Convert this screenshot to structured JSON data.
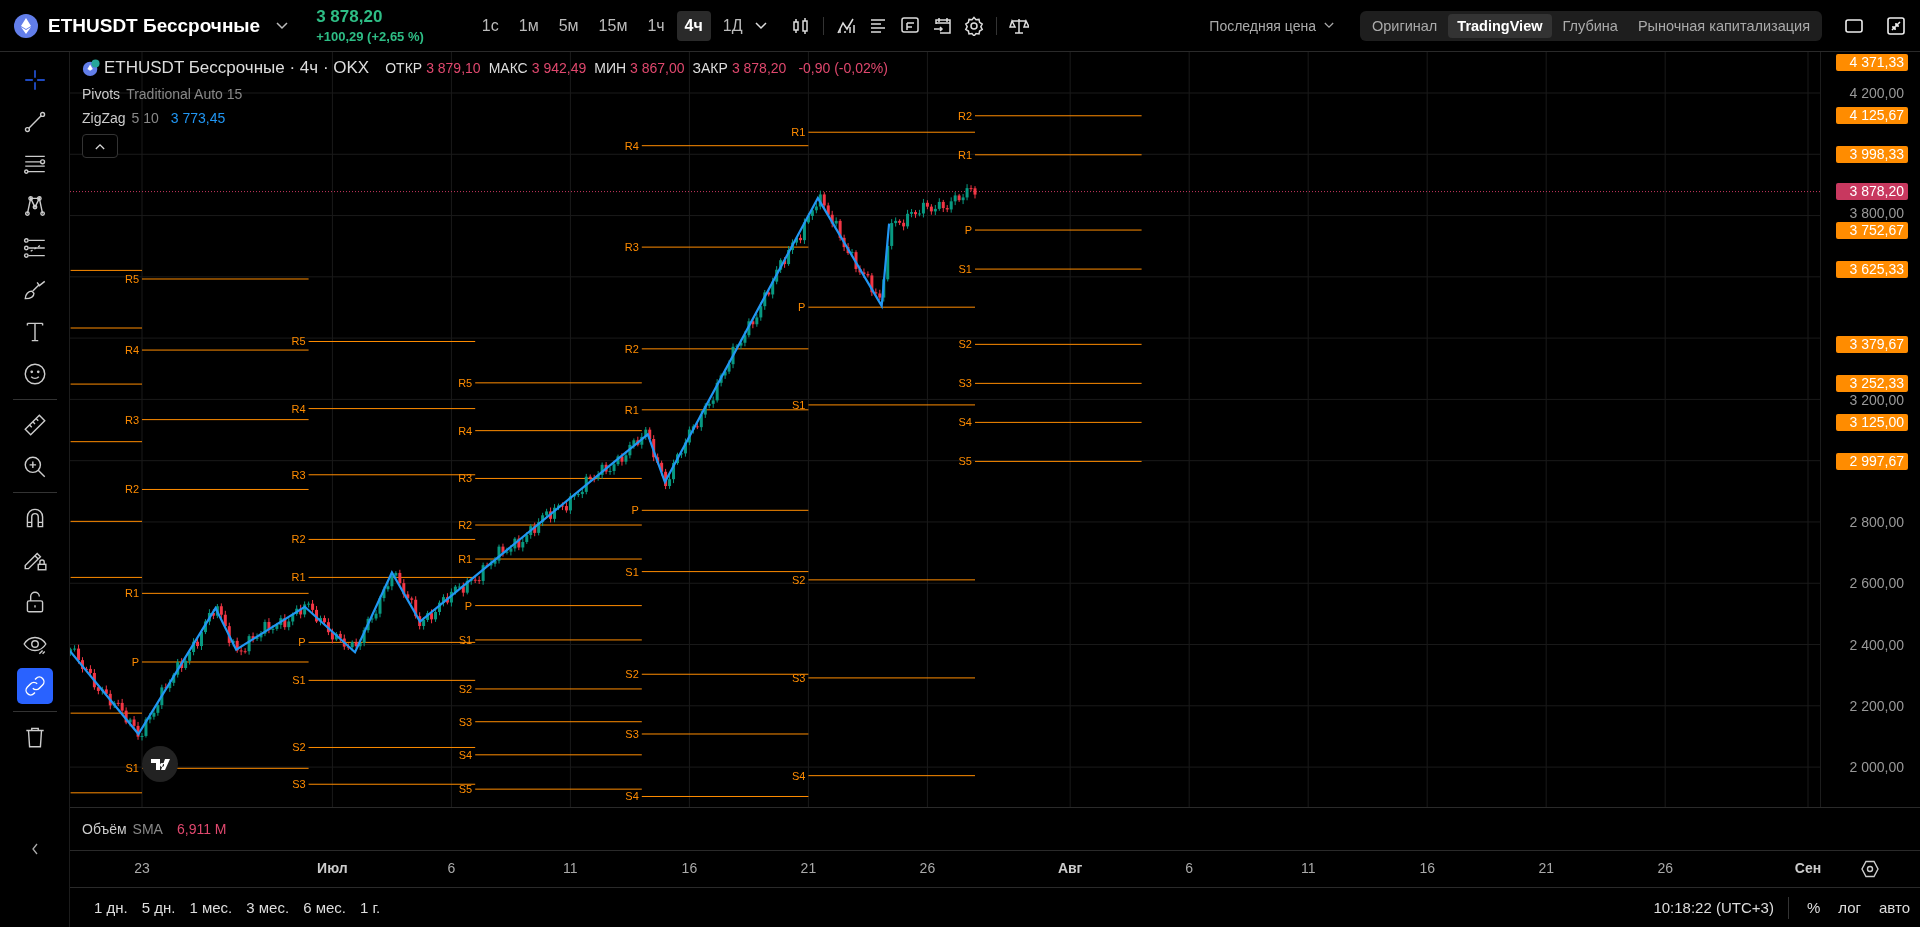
{
  "top_bar": {
    "symbol": "ETHUSDT Бессрочные",
    "price": "3 878,20",
    "change": "+100,29 (+2,65 %)",
    "intervals": [
      {
        "label": "1с",
        "selected": false
      },
      {
        "label": "1м",
        "selected": false
      },
      {
        "label": "5м",
        "selected": false
      },
      {
        "label": "15м",
        "selected": false
      },
      {
        "label": "1ч",
        "selected": false
      },
      {
        "label": "4ч",
        "selected": true
      },
      {
        "label": "1Д",
        "selected": false
      }
    ],
    "price_source": "Последняя цена",
    "views": [
      {
        "label": "Оригинал",
        "selected": false
      },
      {
        "label": "TradingView",
        "selected": true
      },
      {
        "label": "Глубина",
        "selected": false
      },
      {
        "label": "Рыночная капитализация",
        "selected": false
      }
    ]
  },
  "tool_groups": [
    {
      "tools": [
        {
          "kind": "crosshair",
          "selected": true,
          "on": false
        },
        {
          "kind": "line",
          "selected": false,
          "on": false
        },
        {
          "kind": "hlines",
          "selected": false,
          "on": false
        },
        {
          "kind": "pattern",
          "selected": false,
          "on": false
        },
        {
          "kind": "fib",
          "selected": false,
          "on": false
        },
        {
          "kind": "brush",
          "selected": false,
          "on": false
        },
        {
          "kind": "text",
          "selected": false,
          "on": false
        },
        {
          "kind": "smiley",
          "selected": false,
          "on": false
        }
      ]
    },
    {
      "tools": [
        {
          "kind": "ruler",
          "selected": false,
          "on": false
        },
        {
          "kind": "zoom",
          "selected": false,
          "on": false
        }
      ]
    },
    {
      "tools": [
        {
          "kind": "magnet",
          "selected": false,
          "on": false
        },
        {
          "kind": "pencil_lock",
          "selected": false,
          "on": false
        },
        {
          "kind": "lock",
          "selected": false,
          "on": false
        },
        {
          "kind": "eye",
          "selected": false,
          "on": false
        },
        {
          "kind": "link",
          "selected": false,
          "on": true
        }
      ]
    },
    {
      "tools": [
        {
          "kind": "trash",
          "selected": false,
          "on": false
        }
      ]
    }
  ],
  "legend": {
    "title": "ETHUSDT Бессрочные · 4ч · OKX",
    "ohlc": [
      {
        "label": "ОТКР",
        "value": "3 879,10"
      },
      {
        "label": "МАКС",
        "value": "3 942,49"
      },
      {
        "label": "МИН",
        "value": "3 867,00"
      },
      {
        "label": "ЗАКР",
        "value": "3 878,20"
      }
    ],
    "change": "-0,90 (-0,02%)",
    "indicators": [
      {
        "name": "Pivots",
        "params": "Traditional Auto 15"
      },
      {
        "name": "ZigZag",
        "params": "5 10",
        "value": "3 773,45"
      }
    ]
  },
  "chart": {
    "pivot_periods": [
      {
        "labels": [
          "R5",
          "R4",
          "R3",
          "R2",
          "R1",
          "P",
          "S1"
        ]
      },
      {
        "labels": [
          "R5",
          "R4",
          "R3",
          "R2",
          "R1",
          "P",
          "S1",
          "S2",
          "S3"
        ]
      },
      {
        "labels": [
          "R5",
          "R4",
          "R3",
          "R2",
          "R1",
          "P",
          "S1",
          "S2",
          "S3",
          "S4",
          "S5"
        ]
      },
      {
        "labels": [
          "R4",
          "R3",
          "R2",
          "R1",
          "P",
          "S1",
          "S2",
          "S3",
          "S4"
        ]
      },
      {
        "labels": [
          "R1",
          "P",
          "S1",
          "S2",
          "S3",
          "S4"
        ]
      },
      {
        "labels": [
          "R2",
          "R1",
          "P",
          "S1",
          "S2",
          "S3",
          "S4",
          "S5"
        ]
      }
    ],
    "price_ticks": [
      "4 200,00",
      "3 800,00",
      "3 200,00",
      "2 800,00",
      "2 600,00",
      "2 400,00",
      "2 200,00",
      "2 000,00"
    ],
    "price_labels": [
      {
        "text": "4 371,33",
        "color": "#ff8c00"
      },
      {
        "text": "4 125,67",
        "color": "#ff8c00"
      },
      {
        "text": "3 998,33",
        "color": "#ff8c00"
      },
      {
        "text": "3 878,20",
        "color": "#c8385f"
      },
      {
        "text": "3 752,67",
        "color": "#ff8c00"
      },
      {
        "text": "3 625,33",
        "color": "#ff8c00"
      },
      {
        "text": "3 379,67",
        "color": "#ff8c00"
      },
      {
        "text": "3 252,33",
        "color": "#ff8c00"
      },
      {
        "text": "3 125,00",
        "color": "#ff8c00"
      },
      {
        "text": "2 997,67",
        "color": "#ff8c00"
      }
    ],
    "time_ticks": [
      {
        "label": "23",
        "kind": "day"
      },
      {
        "label": "Июл",
        "kind": "month"
      },
      {
        "label": "6",
        "kind": "day"
      },
      {
        "label": "11",
        "kind": "day"
      },
      {
        "label": "16",
        "kind": "day"
      },
      {
        "label": "21",
        "kind": "day"
      },
      {
        "label": "26",
        "kind": "day"
      },
      {
        "label": "Авг",
        "kind": "month"
      },
      {
        "label": "6",
        "kind": "day"
      },
      {
        "label": "11",
        "kind": "day"
      },
      {
        "label": "16",
        "kind": "day"
      },
      {
        "label": "21",
        "kind": "day"
      },
      {
        "label": "26",
        "kind": "day"
      },
      {
        "label": "Сен",
        "kind": "month"
      }
    ]
  },
  "volume": {
    "name": "Объём",
    "params": "SMA",
    "value": "6,911 M"
  },
  "bottom_bar": {
    "ranges": [
      "1 дн.",
      "5 дн.",
      "1 мес.",
      "3 мес.",
      "6 мес.",
      "1 г."
    ],
    "clock": "10:18:22 (UTC+3)",
    "scale_options": [
      "%",
      "лог",
      "авто"
    ]
  }
}
